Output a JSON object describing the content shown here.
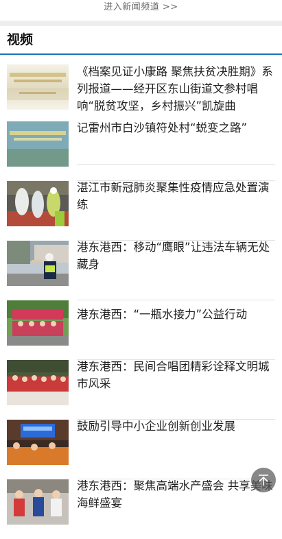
{
  "top_link": "进入新闻频道 >>",
  "section_title": "视频",
  "items": [
    {
      "title": "《档案见证小康路 聚焦扶贫决胜期》系列报道——经开区东山街道文参村唱响“脱贫攻坚，乡村振兴”凯旋曲",
      "thumb": "poster-title-thumb"
    },
    {
      "title": "记雷州市白沙镇符处村“蜕变之路”",
      "thumb": "poster-title-thumb"
    },
    {
      "title": "湛江市新冠肺炎聚集性疫情应急处置演练",
      "thumb": "drill-photo-thumb"
    },
    {
      "title": "港东港西：移动“鹰眼”让违法车辆无处藏身",
      "thumb": "traffic-police-thumb"
    },
    {
      "title": "港东港西：“一瓶水接力”公益行动",
      "thumb": "group-photo-thumb"
    },
    {
      "title": "港东港西：民间合唱团精彩诠释文明城市风采",
      "thumb": "choir-photo-thumb"
    },
    {
      "title": "鼓励引导中小企业创新创业发展",
      "thumb": "meeting-photo-thumb"
    },
    {
      "title": "港东港西：聚焦高端水产盛会 共享美味海鲜盛宴",
      "thumb": "event-photo-thumb"
    }
  ]
}
